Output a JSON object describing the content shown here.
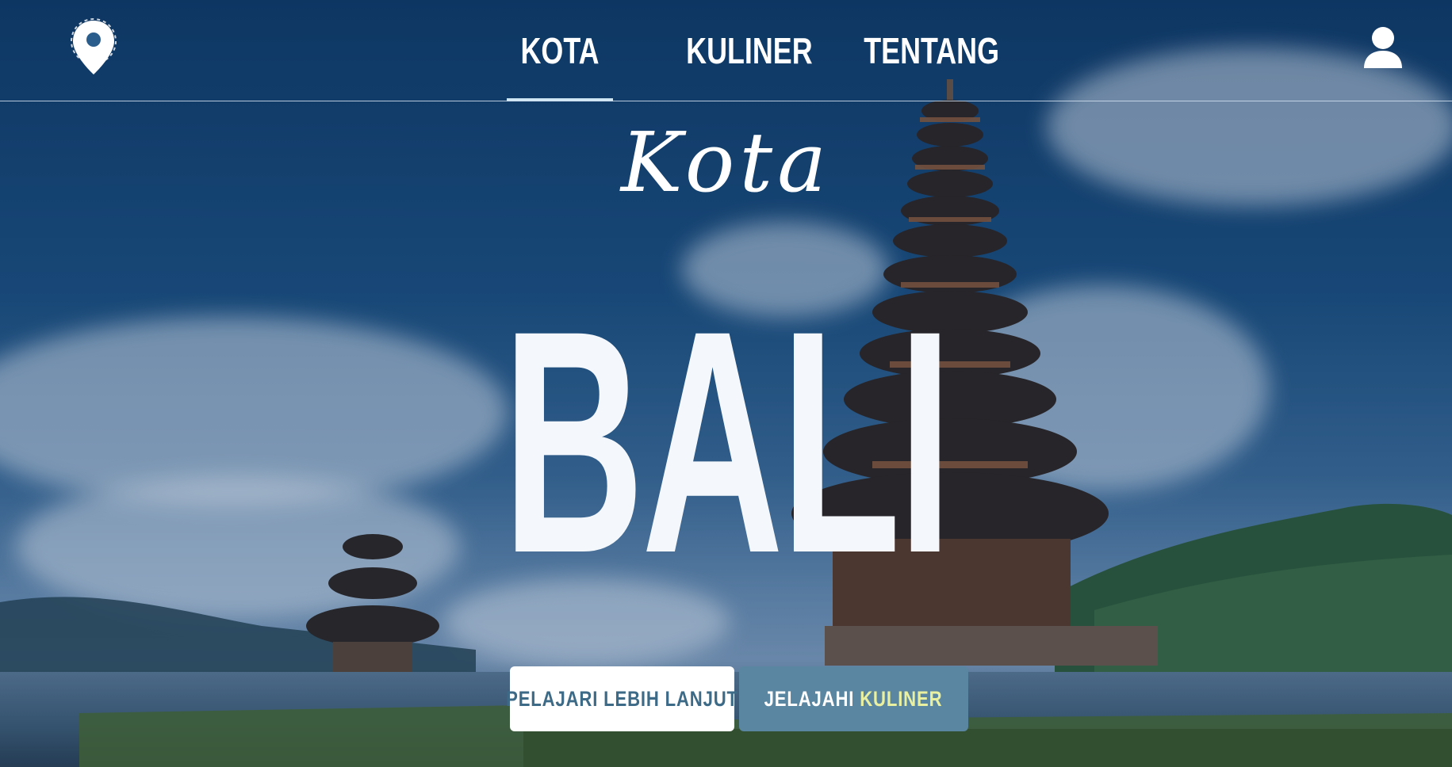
{
  "header": {
    "nav": [
      {
        "label": "KOTA",
        "active": true
      },
      {
        "label": "KULINER",
        "active": false
      },
      {
        "label": "TENTANG",
        "active": false
      }
    ],
    "logo_icon": "map-pin-icon",
    "user_icon": "user-icon"
  },
  "hero": {
    "script_title": "Kota",
    "title": "BALI",
    "primary_button": "PELAJARI LEBIH LANJUT",
    "secondary_button_prefix": "JELAJAHI",
    "secondary_button_accent": "KULINER"
  },
  "colors": {
    "background": "#15406e",
    "button_primary_text": "#3d6a86",
    "button_secondary_bg": "#5a86a1",
    "accent": "#e9f0a0"
  }
}
